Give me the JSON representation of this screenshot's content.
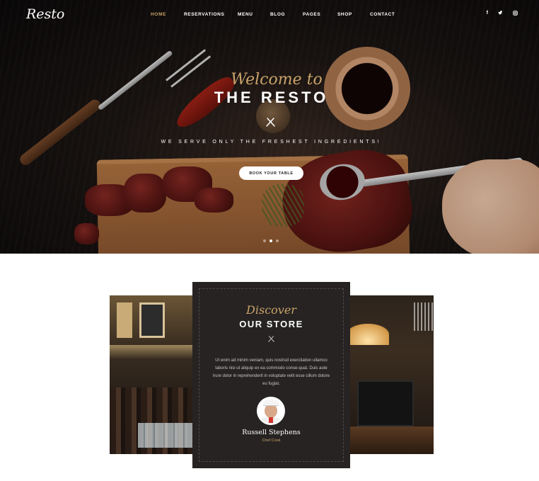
{
  "brand": {
    "logo": "Resto"
  },
  "nav": {
    "items": [
      "HOME",
      "RESERVATIONS",
      "MENU",
      "BLOG",
      "PAGES",
      "SHOP",
      "CONTACT"
    ],
    "active": "HOME"
  },
  "social": {
    "facebook": "f",
    "twitter": "t",
    "instagram": "◙"
  },
  "hero": {
    "welcome": "Welcome to",
    "title": "THE RESTO",
    "icon": "utensils-icon",
    "tagline": "WE SERVE ONLY THE FRESHEST INGREDIENTS!",
    "cta": "BOOK YOUR TABLE",
    "slides": 3,
    "active_slide": 2
  },
  "store": {
    "script_title": "Discover",
    "title": "OUR STORE",
    "icon": "utensils-icon",
    "text": "Ut enim ad minim veniam, quis nostrud exercitation ullamco laboris nisi ut aliquip ex ea commodo conse-quat. Duis aute irure dolor in reprehenderit in voluptate velit esse cillum dolore eu fugiat.",
    "chef": {
      "name": "Russell Stephens",
      "role": "Chef Cook"
    }
  },
  "colors": {
    "accent": "#c9a36a",
    "card": "#262322",
    "hero_dark": "#0b0909"
  }
}
